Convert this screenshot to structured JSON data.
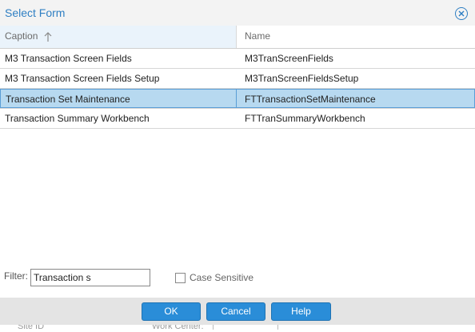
{
  "dialog": {
    "title": "Select Form",
    "close_icon": "close-circle-icon"
  },
  "grid": {
    "columns": [
      {
        "label": "Caption",
        "sort": "ascending"
      },
      {
        "label": "Name"
      }
    ],
    "rows": [
      {
        "caption": "M3 Transaction Screen Fields",
        "name": "M3TranScreenFields",
        "selected": false
      },
      {
        "caption": "M3 Transaction Screen Fields Setup",
        "name": "M3TranScreenFieldsSetup",
        "selected": false
      },
      {
        "caption": "Transaction Set Maintenance",
        "name": "FTTransactionSetMaintenance",
        "selected": true
      },
      {
        "caption": "Transaction Summary Workbench",
        "name": "FTTranSummaryWorkbench",
        "selected": false
      }
    ]
  },
  "filter": {
    "label": "Filter:",
    "value": "Transaction s",
    "case_sensitive_label": "Case Sensitive",
    "case_sensitive_checked": false
  },
  "buttons": {
    "ok": "OK",
    "cancel": "Cancel",
    "help": "Help"
  },
  "background": {
    "left_label": "Site ID",
    "right_label": "Work Center:"
  },
  "colors": {
    "accent": "#2f7fc3",
    "button": "#2a8dd8",
    "selected_row": "#b7d9f0"
  }
}
